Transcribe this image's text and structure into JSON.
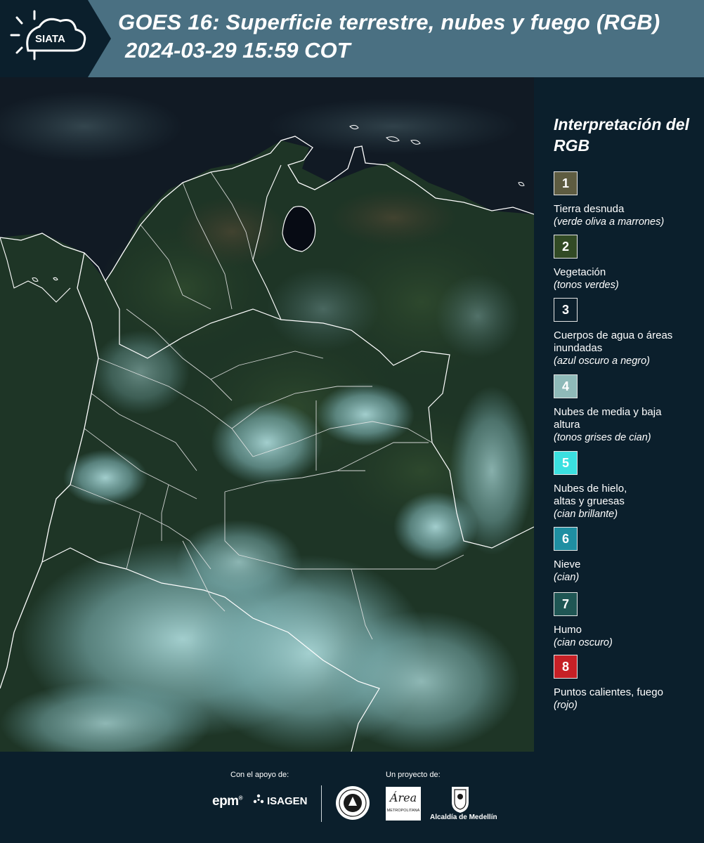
{
  "header": {
    "logo_text": "SIATA",
    "title": "GOES 16: Superficie terrestre, nubes y fuego (RGB)",
    "datetime": "2024-03-29 15:59 COT"
  },
  "map": {
    "icon": "satellite-rgb-map-colombia"
  },
  "legend": {
    "title": "Interpretación del RGB",
    "items": [
      {
        "number": "1",
        "label": "Tierra desnuda",
        "desc": "(verde oliva a marrones)",
        "color": "#5e5c41",
        "text_color": "#ffffff"
      },
      {
        "number": "2",
        "label": "Vegetación",
        "desc": "(tonos verdes)",
        "color": "#324a25",
        "text_color": "#ffffff"
      },
      {
        "number": "3",
        "label": "Cuerpos de agua o áreas inundadas",
        "desc": "(azul oscuro a negro)",
        "color": "#0b1f2c",
        "text_color": "#ffffff"
      },
      {
        "number": "4",
        "label": "Nubes de media y baja altura",
        "desc": "(tonos grises de cian)",
        "color": "#8fbab9",
        "text_color": "#ffffff"
      },
      {
        "number": "5",
        "label": "Nubes de hielo, altas y gruesas",
        "desc": "(cian brillante)",
        "color": "#3be0e0",
        "text_color": "#ffffff"
      },
      {
        "number": "6",
        "label": "Nieve",
        "desc": "(cian)",
        "color": "#1f8fa2",
        "text_color": "#ffffff"
      },
      {
        "number": "7",
        "label": "Humo",
        "desc": "(cian oscuro)",
        "color": "#1f5654",
        "text_color": "#ffffff"
      },
      {
        "number": "8",
        "label": "Puntos calientes, fuego",
        "desc": "(rojo)",
        "color": "#c62026",
        "text_color": "#ffffff"
      }
    ]
  },
  "footer": {
    "support_caption": "Con el apoyo de:",
    "project_caption": "Un proyecto de:",
    "epm_text": "epm",
    "epm_mark": "®",
    "isagen_text": "ISAGEN",
    "area_word": "Área",
    "area_sub": "METROPOLITANA",
    "alcaldia_text": "Alcaldía de Medellín"
  }
}
